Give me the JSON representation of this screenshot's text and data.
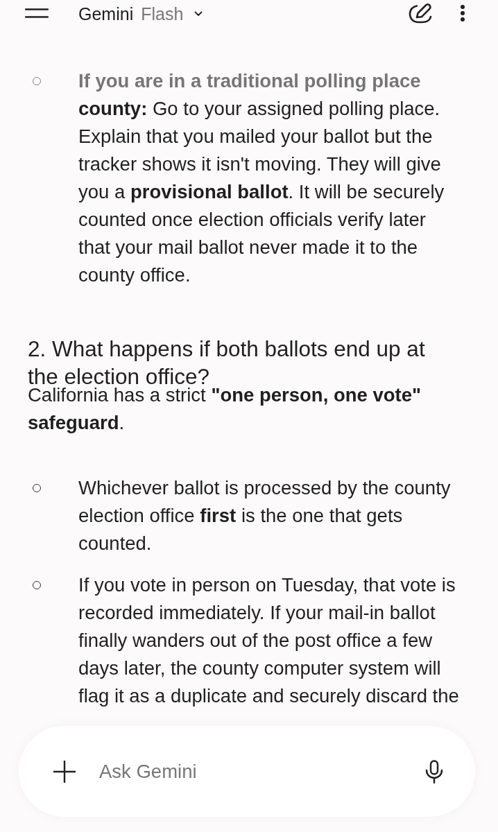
{
  "top_bar": {
    "title": "Gemini",
    "model": "Flash"
  },
  "content": [
    {
      "kind": "bullet",
      "text": "**If you are in a traditional polling place county:** Go to your assigned polling place. Explain that you mailed your ballot but the tracker shows it isn't moving. They will give you a **provisional ballot**. It will be securely counted once election officials verify later that your mail ballot never made it to the county office."
    },
    {
      "kind": "heading",
      "text": "2. What happens if both ballots end up at the election office?"
    },
    {
      "kind": "paragraph",
      "text": "California has a strict **\"one person, one vote\" safeguard**."
    },
    {
      "kind": "bullet",
      "text": "Whichever ballot is processed by the county election office **first** is the one that gets counted."
    },
    {
      "kind": "bullet",
      "text": "If you vote in person on Tuesday, that vote is recorded immediately. If your mail-in ballot finally wanders out of the post office a few days later, the county computer system will flag it as a duplicate and securely discard the"
    }
  ],
  "composer": {
    "placeholder": "Ask Gemini"
  }
}
